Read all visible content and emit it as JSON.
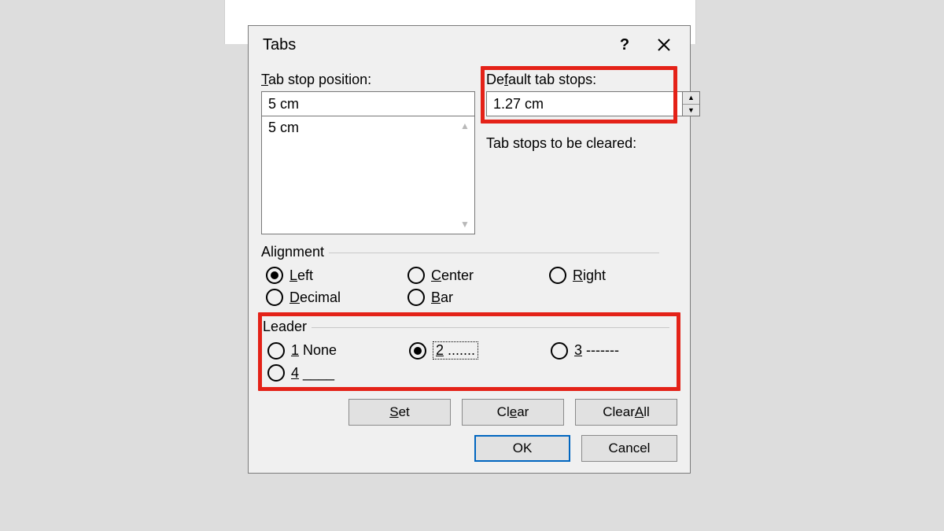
{
  "dialog": {
    "title": "Tabs"
  },
  "tab_stop": {
    "label": "Tab stop position:",
    "value": "5 cm",
    "list": [
      "5 cm"
    ]
  },
  "default_stops": {
    "label": "Default tab stops:",
    "value": "1.27 cm"
  },
  "cleared_label": "Tab stops to be cleared:",
  "alignment": {
    "title": "Alignment",
    "selected": "left",
    "labels": {
      "left": "Left",
      "center": "Center",
      "right": "Right",
      "decimal": "Decimal",
      "bar": "Bar"
    }
  },
  "leader": {
    "title": "Leader",
    "selected": "2",
    "labels": {
      "none": "1 None",
      "two": "2 .......",
      "three": "3 -------",
      "four": "4 ____"
    }
  },
  "buttons": {
    "set": "Set",
    "clear": "Clear",
    "clear_all": "Clear All",
    "ok": "OK",
    "cancel": "Cancel"
  }
}
